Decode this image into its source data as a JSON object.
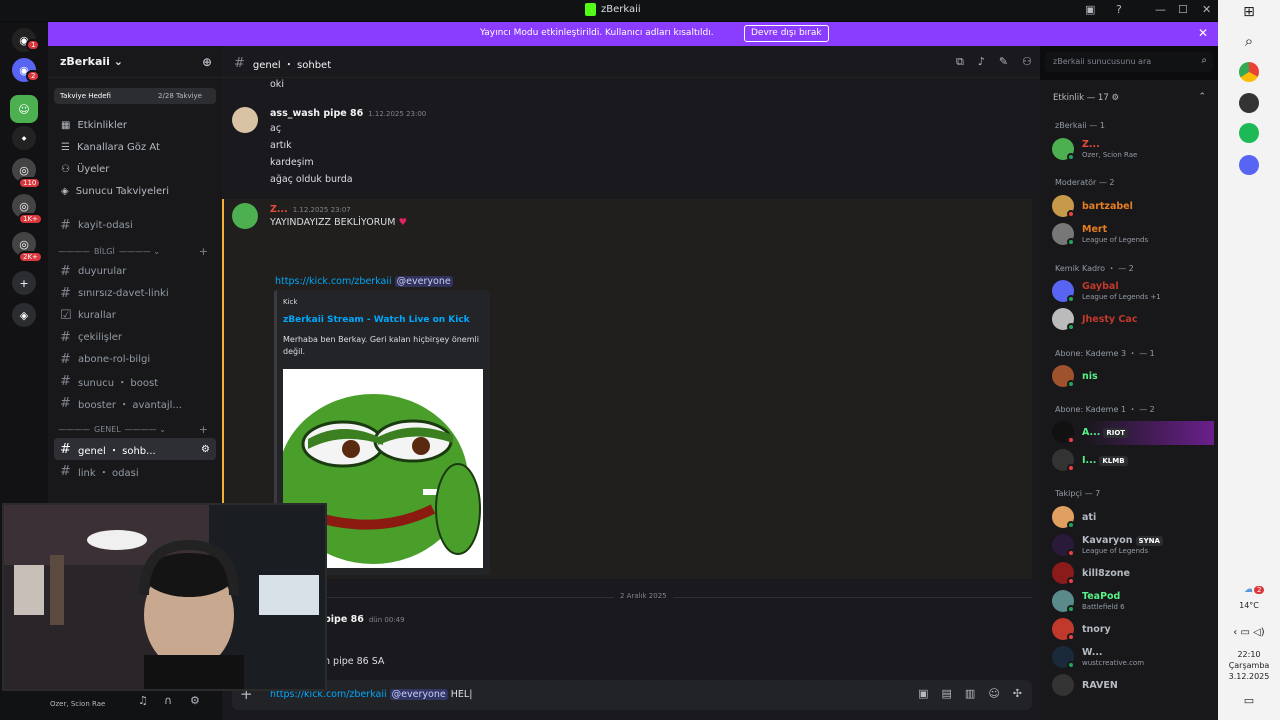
{
  "window": {
    "title": "zBerkaii"
  },
  "banner": {
    "text": "Yayıncı Modu etkinleştirildi. Kullanıcı adları kısaltıldı.",
    "button": "Devre dışı bırak"
  },
  "server": {
    "name": "zBerkaii",
    "boost_label": "Takviye Hedefi",
    "boost_progress": "2/28 Takviye",
    "nav": [
      "Etkinlikler",
      "Kanallara Göz At",
      "Üyeler",
      "Sunucu Takviyeleri"
    ],
    "channels_top": [
      "kayit-odasi"
    ],
    "cat_bilgi": "BİLGİ",
    "bilgi_channels": [
      "duyurular",
      "sınırsız-davet-linki",
      "kurallar",
      "çekilişler",
      "abone-rol-bilgi",
      "sunucu ・ boost",
      "booster ・ avantajl..."
    ],
    "cat_genel": "GENEL",
    "genel_channels": [
      "genel ・ sohb...",
      "link ・ odasi"
    ]
  },
  "rail_badges": [
    "1",
    "2",
    "110",
    "1K+",
    "2K+"
  ],
  "channel_header": {
    "name": "genel ・ sohbet"
  },
  "search": {
    "placeholder": "zBerkaii sunucusunu ara"
  },
  "messages": {
    "first_line": "oki",
    "m1": {
      "author": "ass_wash pipe 86",
      "time": "1.12.2025 23:00",
      "lines": [
        "aç",
        "artık",
        "kardeşim",
        "ağaç olduk burda"
      ]
    },
    "m2": {
      "author": "Z...",
      "time": "1.12.2025 23:07",
      "text": "YAYINDAYIZZ BEKLİYORUM"
    },
    "m2_link": "https://kick.com/zberkaii",
    "m2_mention": "@everyone",
    "embed": {
      "provider": "Kick",
      "title": "zBerkaii Stream - Watch Live on Kick",
      "desc": "Merhaba ben Berkay. Geri kalan hiçbirşey önemli değil."
    },
    "date_divider": "2 Aralık 2025",
    "m3": {
      "author": "pipe 86",
      "time": "dün 00:49",
      "reply": "n pipe 86 SA"
    }
  },
  "input": {
    "link": "https://kick.com/zberkaii",
    "mention": "@everyone",
    "text": "HEL"
  },
  "members": {
    "header": "Etkinlik — 17",
    "groups": [
      {
        "title": "zBerkaii — 1"
      },
      {
        "title": "Moderatör — 2"
      },
      {
        "title": "Kemik Kadro ・ — 2"
      },
      {
        "title": "Abone: Kademe 3 ・ — 1"
      },
      {
        "title": "Abone: Kademe 1 ・ — 2"
      },
      {
        "title": "Takipçi — 7"
      }
    ],
    "list": [
      {
        "name": "Z...",
        "sub": "Ozer, Scion Rae",
        "color": "#e74c3c"
      },
      {
        "name": "bartzabel",
        "sub": "",
        "color": "#e67e22"
      },
      {
        "name": "Mert",
        "sub": "League of Legends",
        "color": "#e67e22"
      },
      {
        "name": "Gaybal",
        "sub": "League of Legends +1",
        "color": "#c0392b"
      },
      {
        "name": "Jhesty Cac",
        "sub": "",
        "color": "#c0392b"
      },
      {
        "name": "nis",
        "sub": "",
        "color": "#57f287"
      },
      {
        "name": "A...",
        "sub": "",
        "color": "#57f287",
        "tag": "RIOT"
      },
      {
        "name": "I...",
        "sub": "",
        "color": "#57f287",
        "tag": "KLMB"
      },
      {
        "name": "ati",
        "sub": "",
        "color": "#b5bac1"
      },
      {
        "name": "Kavaryon",
        "sub": "League of Legends",
        "color": "#b5bac1",
        "tag": "SYNA"
      },
      {
        "name": "kill8zone",
        "sub": "",
        "color": "#b5bac1"
      },
      {
        "name": "TeaPod",
        "sub": "Battlefield 6",
        "color": "#57f287"
      },
      {
        "name": "tnory",
        "sub": "",
        "color": "#b5bac1"
      },
      {
        "name": "W...",
        "sub": "wustcreative.com",
        "color": "#b5bac1"
      },
      {
        "name": "RAVEN",
        "sub": "",
        "color": "#b5bac1"
      }
    ]
  },
  "userbar": {
    "status": "Ozer, Scion Rae"
  },
  "taskbar": {
    "temp": "14°C",
    "time": "22:10",
    "day": "Çarşamba",
    "date": "3.12.2025",
    "weather_badge": "2"
  }
}
